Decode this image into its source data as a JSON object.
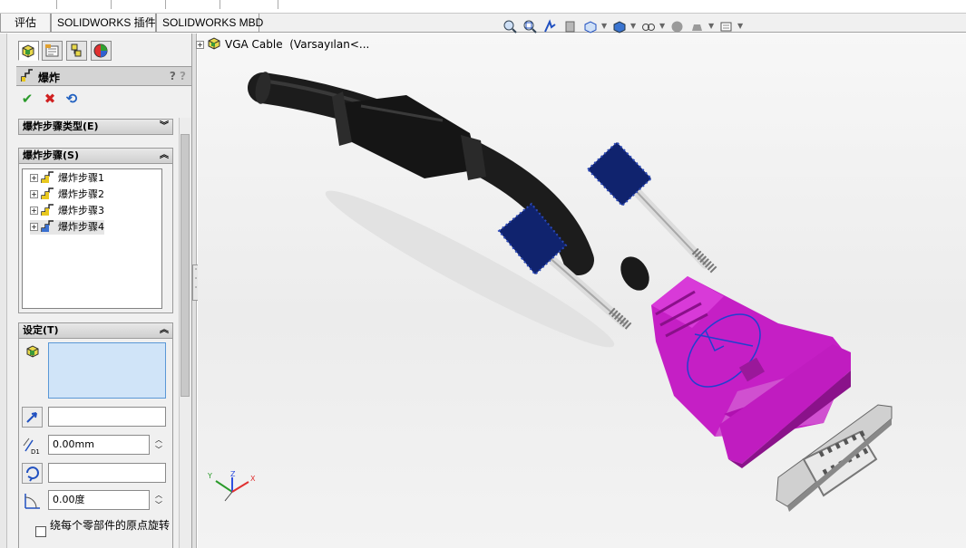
{
  "tabs": [
    "评估",
    "SOLIDWORKS 插件",
    "SOLIDWORKS MBD"
  ],
  "model": {
    "name": "VGA Cable",
    "config": "(Varsayılan<..."
  },
  "property_manager": {
    "title": "爆炸",
    "help_icon": "?"
  },
  "groups": {
    "step_type": {
      "label": "爆炸步骤类型(E)"
    },
    "steps": {
      "label": "爆炸步骤(S)",
      "items": [
        "爆炸步骤1",
        "爆炸步骤2",
        "爆炸步骤3",
        "爆炸步骤4"
      ]
    },
    "settings": {
      "label": "设定(T)",
      "distance_value": "0.00mm",
      "angle_value": "0.00度",
      "checkbox_label": "绕每个零部件的原点旋转"
    }
  },
  "triad": {
    "x": "X",
    "y": "Y",
    "z": "Z"
  },
  "colors": {
    "accent": "#c020c0",
    "cable": "#222222",
    "screw_head": "#1e3a8a",
    "selection": "#d0e4f8"
  }
}
